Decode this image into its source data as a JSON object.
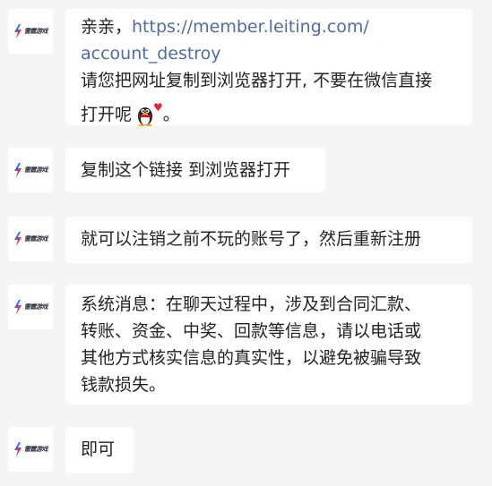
{
  "avatar": {
    "logo_text": "雷霆游戏"
  },
  "messages": [
    {
      "prefix": "亲亲，",
      "link_line1": "https://member.leiting.com/",
      "link_line2": "account_destroy",
      "line3": "请您把网址复制到浏览器打开, 不要在微信直接",
      "line4": "打开呢",
      "suffix": "。",
      "emoji_icon": "penguin-with-heart"
    },
    {
      "text": "复制这个链接 到浏览器打开"
    },
    {
      "text": "就可以注销之前不玩的账号了，然后重新注册"
    },
    {
      "lines": [
        "系统消息：在聊天过程中，涉及到合同汇款、",
        "转账、资金、中奖、回款等信息，请以电话或",
        "其他方式核实信息的真实性，以避免被骗导致",
        "钱款损失。"
      ]
    },
    {
      "text": "即可"
    }
  ],
  "colors": {
    "background": "#f5f5f5",
    "bubble": "#ffffff",
    "link": "#506d9d"
  }
}
